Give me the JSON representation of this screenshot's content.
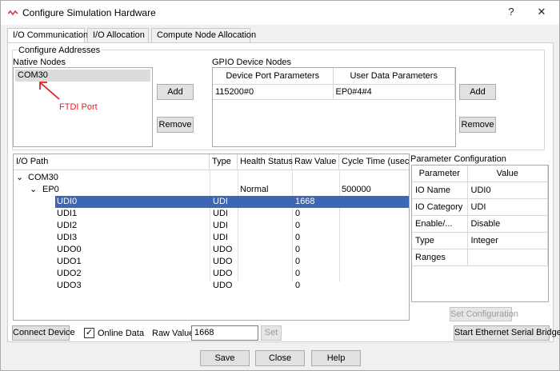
{
  "window": {
    "title": "Configure Simulation Hardware",
    "help_glyph": "?",
    "close_glyph": "✕"
  },
  "tabs": [
    {
      "label": "I/O Communication",
      "active": true
    },
    {
      "label": "I/O Allocation",
      "active": false
    },
    {
      "label": "Compute Node Allocation",
      "active": false
    }
  ],
  "configure_addresses": {
    "title": "Configure Addresses",
    "native_nodes": {
      "label": "Native Nodes",
      "items": [
        "COM30"
      ],
      "add_label": "Add",
      "remove_label": "Remove"
    },
    "annotation": {
      "text": "FTDI Port",
      "color": "#e02020"
    },
    "gpio": {
      "label": "GPIO Device Nodes",
      "columns": [
        "Device Port Parameters",
        "User Data Parameters"
      ],
      "rows": [
        [
          "115200#0",
          "EP0#4#4"
        ]
      ],
      "add_label": "Add",
      "remove_label": "Remove"
    }
  },
  "io_tree": {
    "columns": [
      "I/O Path",
      "Type",
      "Health Status",
      "Raw Value",
      "Cycle Time (usec"
    ],
    "root": "COM30",
    "endpoint": {
      "name": "EP0",
      "health": "Normal",
      "cycle": "500000"
    },
    "rows": [
      {
        "path": "UDI0",
        "type": "UDI",
        "raw": "1668",
        "selected": true
      },
      {
        "path": "UDI1",
        "type": "UDI",
        "raw": "0",
        "selected": false
      },
      {
        "path": "UDI2",
        "type": "UDI",
        "raw": "0",
        "selected": false
      },
      {
        "path": "UDI3",
        "type": "UDI",
        "raw": "0",
        "selected": false
      },
      {
        "path": "UDO0",
        "type": "UDO",
        "raw": "0",
        "selected": false
      },
      {
        "path": "UDO1",
        "type": "UDO",
        "raw": "0",
        "selected": false
      },
      {
        "path": "UDO2",
        "type": "UDO",
        "raw": "0",
        "selected": false
      },
      {
        "path": "UDO3",
        "type": "UDO",
        "raw": "0",
        "selected": false
      }
    ],
    "selection_color": "#3e66b6"
  },
  "param_config": {
    "title": "Parameter Configuration",
    "columns": [
      "Parameter",
      "Value"
    ],
    "rows": [
      [
        "IO Name",
        "UDI0"
      ],
      [
        "IO Category",
        "UDI"
      ],
      [
        "Enable/...",
        "Disable"
      ],
      [
        "Type",
        "Integer"
      ],
      [
        "Ranges",
        ""
      ]
    ],
    "set_config_label": "Set Configuration",
    "bridge_label": "Start Ethernet Serial Bridge"
  },
  "bottom": {
    "connect_label": "Connect Device",
    "online_label": "Online Data",
    "online_checked": "✓",
    "raw_value_label": "Raw Value",
    "raw_value": "1668",
    "set_label": "Set"
  },
  "footer": {
    "save_label": "Save",
    "close_label": "Close",
    "help_label": "Help"
  }
}
